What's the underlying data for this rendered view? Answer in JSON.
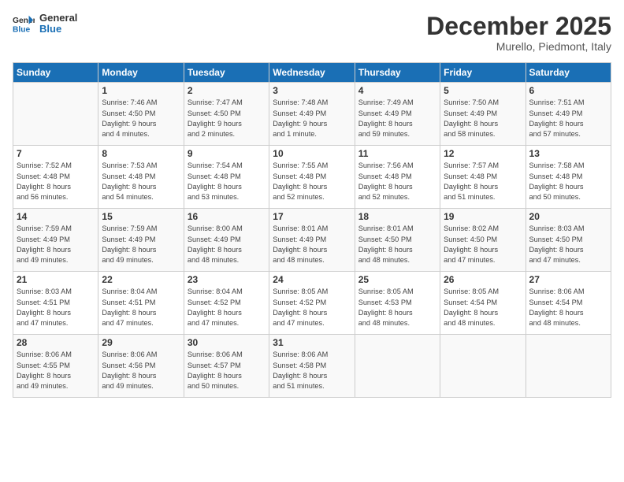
{
  "header": {
    "logo_line1": "General",
    "logo_line2": "Blue",
    "month_title": "December 2025",
    "location": "Murello, Piedmont, Italy"
  },
  "days_of_week": [
    "Sunday",
    "Monday",
    "Tuesday",
    "Wednesday",
    "Thursday",
    "Friday",
    "Saturday"
  ],
  "weeks": [
    [
      {
        "day": "",
        "info": ""
      },
      {
        "day": "1",
        "info": "Sunrise: 7:46 AM\nSunset: 4:50 PM\nDaylight: 9 hours\nand 4 minutes."
      },
      {
        "day": "2",
        "info": "Sunrise: 7:47 AM\nSunset: 4:50 PM\nDaylight: 9 hours\nand 2 minutes."
      },
      {
        "day": "3",
        "info": "Sunrise: 7:48 AM\nSunset: 4:49 PM\nDaylight: 9 hours\nand 1 minute."
      },
      {
        "day": "4",
        "info": "Sunrise: 7:49 AM\nSunset: 4:49 PM\nDaylight: 8 hours\nand 59 minutes."
      },
      {
        "day": "5",
        "info": "Sunrise: 7:50 AM\nSunset: 4:49 PM\nDaylight: 8 hours\nand 58 minutes."
      },
      {
        "day": "6",
        "info": "Sunrise: 7:51 AM\nSunset: 4:49 PM\nDaylight: 8 hours\nand 57 minutes."
      }
    ],
    [
      {
        "day": "7",
        "info": "Sunrise: 7:52 AM\nSunset: 4:48 PM\nDaylight: 8 hours\nand 56 minutes."
      },
      {
        "day": "8",
        "info": "Sunrise: 7:53 AM\nSunset: 4:48 PM\nDaylight: 8 hours\nand 54 minutes."
      },
      {
        "day": "9",
        "info": "Sunrise: 7:54 AM\nSunset: 4:48 PM\nDaylight: 8 hours\nand 53 minutes."
      },
      {
        "day": "10",
        "info": "Sunrise: 7:55 AM\nSunset: 4:48 PM\nDaylight: 8 hours\nand 52 minutes."
      },
      {
        "day": "11",
        "info": "Sunrise: 7:56 AM\nSunset: 4:48 PM\nDaylight: 8 hours\nand 52 minutes."
      },
      {
        "day": "12",
        "info": "Sunrise: 7:57 AM\nSunset: 4:48 PM\nDaylight: 8 hours\nand 51 minutes."
      },
      {
        "day": "13",
        "info": "Sunrise: 7:58 AM\nSunset: 4:48 PM\nDaylight: 8 hours\nand 50 minutes."
      }
    ],
    [
      {
        "day": "14",
        "info": "Sunrise: 7:59 AM\nSunset: 4:49 PM\nDaylight: 8 hours\nand 49 minutes."
      },
      {
        "day": "15",
        "info": "Sunrise: 7:59 AM\nSunset: 4:49 PM\nDaylight: 8 hours\nand 49 minutes."
      },
      {
        "day": "16",
        "info": "Sunrise: 8:00 AM\nSunset: 4:49 PM\nDaylight: 8 hours\nand 48 minutes."
      },
      {
        "day": "17",
        "info": "Sunrise: 8:01 AM\nSunset: 4:49 PM\nDaylight: 8 hours\nand 48 minutes."
      },
      {
        "day": "18",
        "info": "Sunrise: 8:01 AM\nSunset: 4:50 PM\nDaylight: 8 hours\nand 48 minutes."
      },
      {
        "day": "19",
        "info": "Sunrise: 8:02 AM\nSunset: 4:50 PM\nDaylight: 8 hours\nand 47 minutes."
      },
      {
        "day": "20",
        "info": "Sunrise: 8:03 AM\nSunset: 4:50 PM\nDaylight: 8 hours\nand 47 minutes."
      }
    ],
    [
      {
        "day": "21",
        "info": "Sunrise: 8:03 AM\nSunset: 4:51 PM\nDaylight: 8 hours\nand 47 minutes."
      },
      {
        "day": "22",
        "info": "Sunrise: 8:04 AM\nSunset: 4:51 PM\nDaylight: 8 hours\nand 47 minutes."
      },
      {
        "day": "23",
        "info": "Sunrise: 8:04 AM\nSunset: 4:52 PM\nDaylight: 8 hours\nand 47 minutes."
      },
      {
        "day": "24",
        "info": "Sunrise: 8:05 AM\nSunset: 4:52 PM\nDaylight: 8 hours\nand 47 minutes."
      },
      {
        "day": "25",
        "info": "Sunrise: 8:05 AM\nSunset: 4:53 PM\nDaylight: 8 hours\nand 48 minutes."
      },
      {
        "day": "26",
        "info": "Sunrise: 8:05 AM\nSunset: 4:54 PM\nDaylight: 8 hours\nand 48 minutes."
      },
      {
        "day": "27",
        "info": "Sunrise: 8:06 AM\nSunset: 4:54 PM\nDaylight: 8 hours\nand 48 minutes."
      }
    ],
    [
      {
        "day": "28",
        "info": "Sunrise: 8:06 AM\nSunset: 4:55 PM\nDaylight: 8 hours\nand 49 minutes."
      },
      {
        "day": "29",
        "info": "Sunrise: 8:06 AM\nSunset: 4:56 PM\nDaylight: 8 hours\nand 49 minutes."
      },
      {
        "day": "30",
        "info": "Sunrise: 8:06 AM\nSunset: 4:57 PM\nDaylight: 8 hours\nand 50 minutes."
      },
      {
        "day": "31",
        "info": "Sunrise: 8:06 AM\nSunset: 4:58 PM\nDaylight: 8 hours\nand 51 minutes."
      },
      {
        "day": "",
        "info": ""
      },
      {
        "day": "",
        "info": ""
      },
      {
        "day": "",
        "info": ""
      }
    ]
  ]
}
